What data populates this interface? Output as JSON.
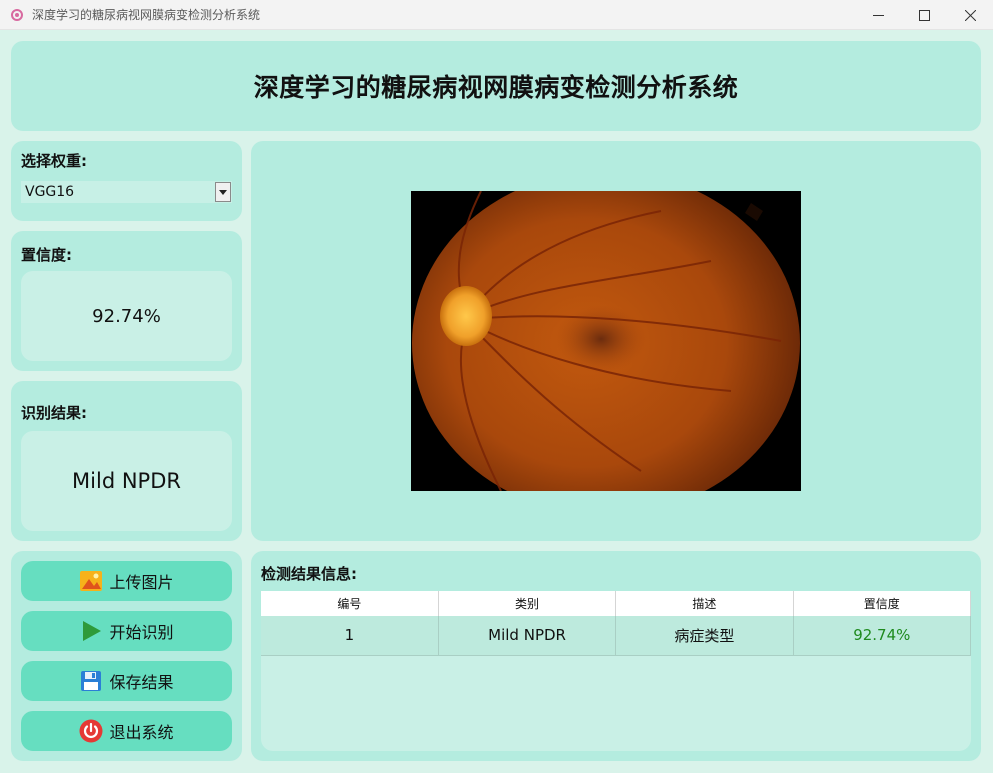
{
  "window": {
    "title": "深度学习的糖尿病视网膜病变检测分析系统"
  },
  "header": {
    "title": "深度学习的糖尿病视网膜病变检测分析系统"
  },
  "weights": {
    "label": "选择权重:",
    "selected": "VGG16"
  },
  "confidence": {
    "label": "置信度:",
    "value": "92.74%"
  },
  "result": {
    "label": "识别结果:",
    "value": "Mild NPDR"
  },
  "buttons": {
    "upload": "上传图片",
    "start": "开始识别",
    "save": "保存结果",
    "exit": "退出系统"
  },
  "info": {
    "label": "检测结果信息:",
    "columns": [
      "编号",
      "类别",
      "描述",
      "置信度"
    ],
    "rows": [
      [
        "1",
        "Mild NPDR",
        "病症类型",
        "92.74%"
      ]
    ]
  },
  "colors": {
    "panel": "#b4ecdf",
    "button": "#66dec0",
    "confidence_text": "#1e8a1e"
  }
}
